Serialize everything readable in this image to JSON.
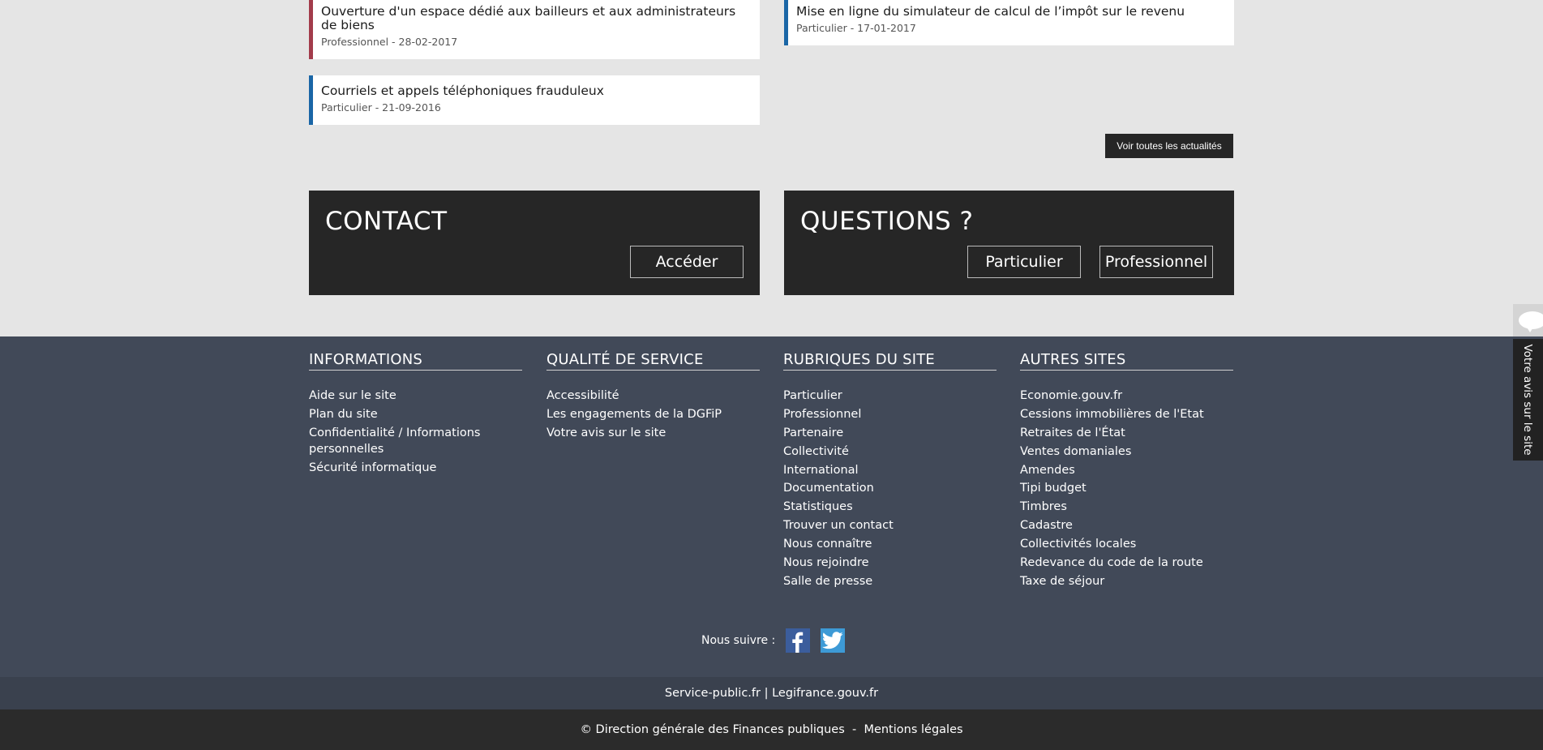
{
  "news": [
    {
      "title": "Ouverture d'un espace dédié aux bailleurs et aux administrateurs de biens",
      "meta": "Professionnel - 28-02-2017"
    },
    {
      "title": "Mise en ligne du simulateur de calcul de l’impôt sur le revenu",
      "meta": "Particulier - 17-01-2017"
    },
    {
      "title": "Courriels et appels téléphoniques frauduleux",
      "meta": "Particulier - 21-09-2016"
    }
  ],
  "news_all_button": "Voir toutes les actualités",
  "contact": {
    "title": "CONTACT",
    "button": "Accéder"
  },
  "questions": {
    "title": "QUESTIONS ?",
    "button_particulier": "Particulier",
    "button_professionnel": "Professionnel"
  },
  "footer": {
    "columns": [
      {
        "title": "INFORMATIONS",
        "links": [
          "Aide sur le site",
          "Plan du site",
          "Confidentialité / Informations personnelles",
          "Sécurité informatique"
        ]
      },
      {
        "title": "QUALITÉ DE SERVICE",
        "links": [
          "Accessibilité",
          "Les engagements de la DGFiP",
          "Votre avis sur le site"
        ]
      },
      {
        "title": "RUBRIQUES DU SITE",
        "links": [
          "Particulier",
          "Professionnel",
          "Partenaire",
          "Collectivité",
          "International",
          "Documentation",
          "Statistiques",
          "Trouver un contact",
          "Nous connaître",
          "Nous rejoindre",
          "Salle de presse"
        ]
      },
      {
        "title": "AUTRES SITES",
        "links": [
          "Economie.gouv.fr",
          "Cessions immobilières de l'Etat",
          "Retraites de l'État",
          "Ventes domaniales",
          "Amendes",
          "Tipi budget",
          "Timbres",
          "Cadastre",
          "Collectivités locales",
          "Redevance du code de la route",
          "Taxe de séjour"
        ]
      }
    ],
    "follow_label": "Nous suivre :",
    "social": [
      {
        "name": "facebook-icon",
        "glyph": "f"
      },
      {
        "name": "twitter-icon",
        "glyph": "t"
      }
    ],
    "band_links": {
      "left": "Service-public.fr",
      "sep": " | ",
      "right": "Legifrance.gouv.fr"
    },
    "copyright": "© Direction générale des Finances publiques",
    "copyright_sep": "  -  ",
    "legal": "Mentions légales"
  },
  "feedback_tab": "Votre avis sur le site",
  "colors": {
    "particulier": "#1a66a6",
    "professionnel": "#a23b4b",
    "footer_bg": "#414958",
    "dark": "#262626"
  }
}
